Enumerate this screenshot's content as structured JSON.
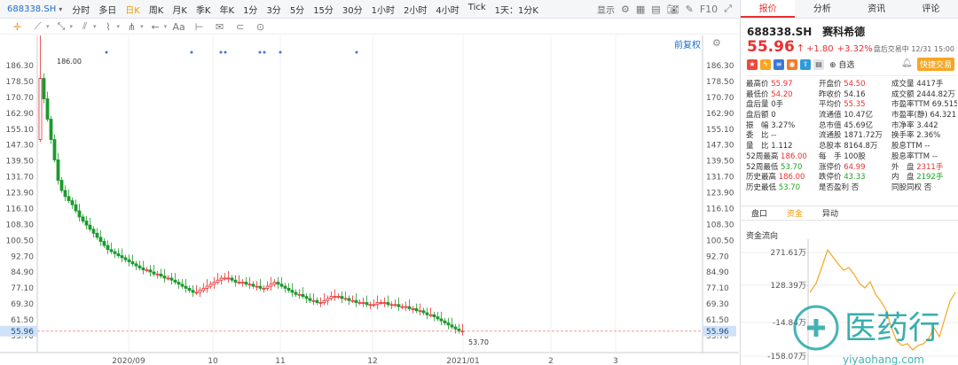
{
  "topbar": {
    "symbol": "688338.SH",
    "periods": [
      "分时",
      "多日",
      "日K",
      "周K",
      "月K",
      "季K",
      "年K",
      "1分",
      "3分",
      "5分",
      "15分",
      "30分",
      "1小时",
      "2小时",
      "4小时",
      "Tick",
      "1天：1分K"
    ],
    "active_period": "日K",
    "display_label": "显示"
  },
  "toolbar": {
    "tools": [
      "crosshair-icon",
      "line-icon",
      "ray-icon",
      "channel-icon",
      "wave-icon",
      "fib-icon",
      "arrow-icon",
      "text-icon",
      "measure-icon",
      "note-icon",
      "link-icon",
      "shape-icon"
    ]
  },
  "chart": {
    "adjust_label": "前复权",
    "current_price_tag": "55.96",
    "y_ticks": [
      "186.30",
      "178.50",
      "170.70",
      "162.90",
      "155.10",
      "147.30",
      "139.50",
      "131.70",
      "123.90",
      "116.10",
      "108.30",
      "100.50",
      "92.70",
      "84.90",
      "77.10",
      "69.30",
      "61.50",
      "53.70"
    ],
    "x_ticks": [
      "2020/09",
      "10",
      "11",
      "12",
      "2021/01",
      "2",
      "3"
    ],
    "high_label": "186.00",
    "low_label": "53.70"
  },
  "chart_data": {
    "type": "candlestick",
    "title": "",
    "xlabel": "",
    "ylabel": "",
    "ylim": [
      53.7,
      186.3
    ],
    "x_ticks": [
      "2020/09",
      "10",
      "11",
      "12",
      "2021/01",
      "2",
      "3"
    ],
    "markers": {
      "high": 186.0,
      "low": 53.7,
      "last": 55.96
    },
    "close_approx": [
      180,
      170,
      160,
      150,
      140,
      130,
      125,
      122,
      120,
      118,
      115,
      112,
      110,
      108,
      106,
      104,
      102,
      100,
      98,
      96,
      95,
      94,
      93,
      92,
      91,
      90,
      89,
      88,
      87,
      86,
      86,
      85,
      84,
      84,
      83,
      82,
      82,
      81,
      80,
      79,
      78,
      77,
      76,
      75,
      75,
      76,
      77,
      78,
      79,
      80,
      81,
      82,
      82,
      82,
      81,
      80,
      80,
      80,
      79,
      79,
      78,
      78,
      77,
      77,
      78,
      79,
      80,
      79,
      78,
      77,
      76,
      75,
      74,
      74,
      73,
      72,
      71,
      71,
      70,
      70,
      71,
      72,
      73,
      73,
      73,
      72,
      72,
      71,
      71,
      70,
      70,
      70,
      69,
      69,
      69,
      70,
      70,
      70,
      69,
      69,
      69,
      68,
      68,
      68,
      67,
      67,
      66,
      66,
      65,
      64,
      64,
      63,
      62,
      61,
      60,
      59,
      58,
      57,
      56,
      56
    ]
  },
  "panel": {
    "tabs": [
      "报价",
      "分析",
      "资讯",
      "评论"
    ],
    "active_tab": "报价",
    "code": "688338.SH",
    "name": "赛科希德",
    "price": "55.96",
    "arrow": "↑",
    "change": "+1.80",
    "change_pct": "+3.32%",
    "close_time": "盘后交易中 12/31 15:00",
    "add_fav": "自选",
    "quick_trade": "快捷交易",
    "stats": [
      [
        {
          "l": "最高价",
          "v": "55.97",
          "c": "red"
        },
        {
          "l": "开盘价",
          "v": "54.50",
          "c": "red"
        },
        {
          "l": "成交量",
          "v": "4417手",
          "c": ""
        }
      ],
      [
        {
          "l": "最低价",
          "v": "54.20",
          "c": "red"
        },
        {
          "l": "昨收价",
          "v": "54.16",
          "c": ""
        },
        {
          "l": "成交额",
          "v": "2444.82万",
          "c": ""
        }
      ],
      [
        {
          "l": "盘后量",
          "v": "0手",
          "c": ""
        },
        {
          "l": "平均价",
          "v": "55.35",
          "c": "red"
        },
        {
          "l": "市盈率TTM",
          "v": "69.515",
          "c": ""
        }
      ],
      [
        {
          "l": "盘后额",
          "v": "0",
          "c": ""
        },
        {
          "l": "流通值",
          "v": "10.47亿",
          "c": ""
        },
        {
          "l": "市盈率(静)",
          "v": "64.321",
          "c": ""
        }
      ],
      [
        {
          "l": "振　幅",
          "v": "3.27%",
          "c": ""
        },
        {
          "l": "总市值",
          "v": "45.69亿",
          "c": ""
        },
        {
          "l": "市净率",
          "v": "3.442",
          "c": ""
        }
      ],
      [
        {
          "l": "委　比",
          "v": "--",
          "c": ""
        },
        {
          "l": "流通股",
          "v": "1871.72万",
          "c": ""
        },
        {
          "l": "换手率",
          "v": "2.36%",
          "c": ""
        }
      ],
      [
        {
          "l": "量　比",
          "v": "1.112",
          "c": ""
        },
        {
          "l": "总股本",
          "v": "8164.8万",
          "c": ""
        },
        {
          "l": "股息TTM",
          "v": "--",
          "c": ""
        }
      ],
      [
        {
          "l": "52周最高",
          "v": "186.00",
          "c": "red"
        },
        {
          "l": "每　手",
          "v": "100股",
          "c": ""
        },
        {
          "l": "股息率TTM",
          "v": "--",
          "c": ""
        }
      ],
      [
        {
          "l": "52周最低",
          "v": "53.70",
          "c": "green"
        },
        {
          "l": "涨停价",
          "v": "64.99",
          "c": "red"
        },
        {
          "l": "外　盘",
          "v": "2311手",
          "c": "red"
        }
      ],
      [
        {
          "l": "历史最高",
          "v": "186.00",
          "c": "red"
        },
        {
          "l": "跌停价",
          "v": "43.33",
          "c": "green"
        },
        {
          "l": "内　盘",
          "v": "2192手",
          "c": "green"
        }
      ],
      [
        {
          "l": "历史最低",
          "v": "53.70",
          "c": "green"
        },
        {
          "l": "是否盈利",
          "v": "否",
          "c": ""
        },
        {
          "l": "同股同权",
          "v": "否",
          "c": ""
        }
      ]
    ],
    "subtabs": [
      "盘口",
      "资金",
      "异动"
    ],
    "active_subtab": "资金",
    "flow_title": "资金流向",
    "flow_ticks": [
      "271.61万",
      "128.39万",
      "-14.84万",
      "-158.07万"
    ]
  },
  "watermark": {
    "cn": "医药行",
    "en": "yiyaohang.com"
  }
}
